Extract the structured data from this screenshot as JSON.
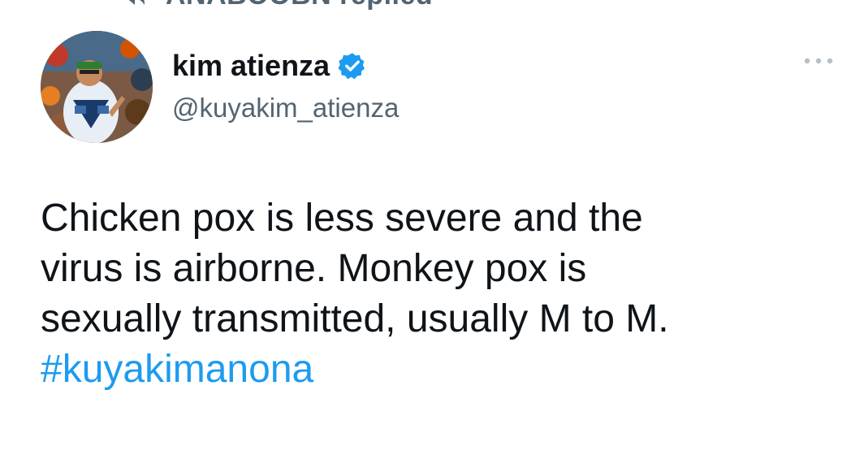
{
  "tweet": {
    "social_context": "ANABOOBN replied",
    "author": {
      "display_name": "kim atienza",
      "handle": "@kuyakim_atienza",
      "verified": true,
      "avatar_icon": "profile-photo"
    },
    "more_icon": "more-dots-icon",
    "text_lines": [
      "Chicken pox is less severe and the",
      "virus is airborne. Monkey pox is",
      "sexually transmitted, usually M to M."
    ],
    "hashtag": "#kuyakimanona"
  },
  "colors": {
    "text_primary": "#0f1419",
    "text_secondary": "#536471",
    "link": "#1d9bf0",
    "verified": "#1d9bf0",
    "background": "#ffffff"
  }
}
